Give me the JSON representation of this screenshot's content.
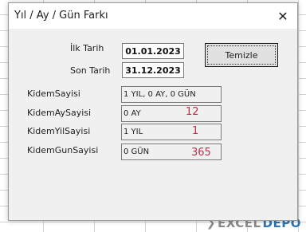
{
  "window": {
    "title": "Yıl / Ay / Gün Farkı",
    "close_label": "✕"
  },
  "form": {
    "ilk_tarih_label": "İlk Tarih",
    "ilk_tarih_value": "01.01.2023",
    "son_tarih_label": "Son Tarih",
    "son_tarih_value": "31.12.2023",
    "clear_button": "Temizle"
  },
  "results": [
    {
      "label": "KidemSayisi",
      "value": "1 YIL, 0 AY, 0 GÜN"
    },
    {
      "label": "KidemAySayisi",
      "value": "0 AY"
    },
    {
      "label": "KidemYilSayisi",
      "value": "1 YIL"
    },
    {
      "label": "KidemGunSayisi",
      "value": "0 GÜN"
    }
  ],
  "annotations": {
    "ay": "12",
    "yil": "1",
    "gun": "365"
  },
  "watermark": {
    "brand_a": "EXCEL",
    "brand_b": "DEPO"
  },
  "colors": {
    "annotation": "#c42b4a",
    "dialog_bg": "#f0f0f0",
    "brand": "#2f74b5"
  }
}
